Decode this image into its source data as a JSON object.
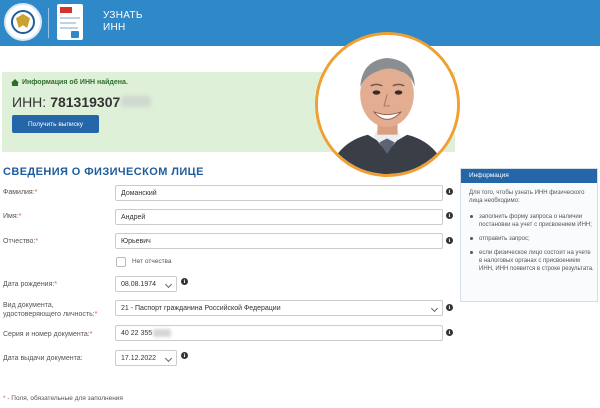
{
  "header": {
    "title": "УЗНАТЬ\nИНН"
  },
  "result": {
    "found_text": "Информация об ИНН найдена.",
    "inn_label": "ИНН:",
    "inn_value": "781319307",
    "button_label": "Получить выписку"
  },
  "section": {
    "title": "СВЕДЕНИЯ О ФИЗИЧЕСКОМ ЛИЦЕ"
  },
  "form": {
    "surname": {
      "label": "Фамилия:",
      "value": "Доманский"
    },
    "name": {
      "label": "Имя:",
      "value": "Андрей"
    },
    "patronymic": {
      "label": "Отчество:",
      "value": "Юрьевич"
    },
    "no_patronymic": "Нет отчества",
    "birth_date": {
      "label": "Дата рождения:",
      "value": "08.08.1974"
    },
    "doc_type": {
      "label_line1": "Вид документа,",
      "label_line2": "удостоверяющего личность:",
      "value": "21 - Паспорт гражданина Российской Федерации"
    },
    "doc_number": {
      "label": "Серия и номер документа:",
      "value": "40 22 355"
    },
    "issue_date": {
      "label": "Дата выдачи документа:",
      "value": "17.12.2022"
    },
    "required_star": "*",
    "required_note": " - Поля, обязательные для заполнения",
    "info_glyph": "i"
  },
  "info": {
    "title": "Информация",
    "intro": "Для того, чтобы узнать ИНН физического лица необходимо:",
    "items": [
      "заполнить форму запроса о наличии постановки на учет с присвоением ИНН;",
      "отправить запрос;",
      "если физическое лицо состоит на учете в налоговых органах с присвоением ИНН, ИНН появится в строке результата."
    ]
  },
  "colors": {
    "header_bg": "#2f88c7",
    "found_bg": "#dff0d8",
    "button_bg": "#2466a8",
    "avatar_ring": "#f0a032",
    "required": "#d9534f"
  }
}
